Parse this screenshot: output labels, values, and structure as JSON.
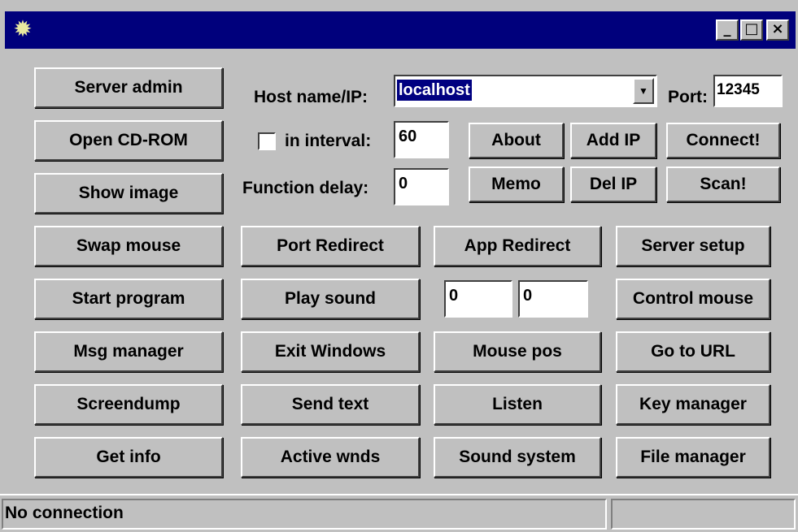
{
  "window": {
    "icon": "sun-gear-icon",
    "controls": {
      "minimize": "_",
      "maximize": "□",
      "close": "×"
    }
  },
  "left_buttons": [
    "Server admin",
    "Open CD-ROM",
    "Show image",
    "Swap mouse",
    "Start program",
    "Msg manager",
    "Screendump",
    "Get info"
  ],
  "host": {
    "label": "Host name/IP:",
    "value": "localhost",
    "port_label": "Port:",
    "port_value": "12345"
  },
  "interval": {
    "label": "in interval:",
    "value": "60",
    "checked": false
  },
  "function_delay": {
    "label": "Function delay:",
    "value": "0"
  },
  "small_buttons": {
    "about": "About",
    "add_ip": "Add IP",
    "connect": "Connect!",
    "memo": "Memo",
    "del_ip": "Del IP",
    "scan": "Scan!"
  },
  "col2_buttons": [
    "Port Redirect",
    "Play sound",
    "Exit Windows",
    "Send text",
    "Active wnds"
  ],
  "col3_buttons": {
    "app_redirect": "App Redirect",
    "mouse_pos": "Mouse pos",
    "listen": "Listen",
    "sound_system": "Sound system"
  },
  "coords": {
    "x": "0",
    "y": "0"
  },
  "col4_buttons": [
    "Server setup",
    "Control mouse",
    "Go to URL",
    "Key manager",
    "File manager"
  ],
  "status": {
    "text": "No connection",
    "secondary": ""
  }
}
